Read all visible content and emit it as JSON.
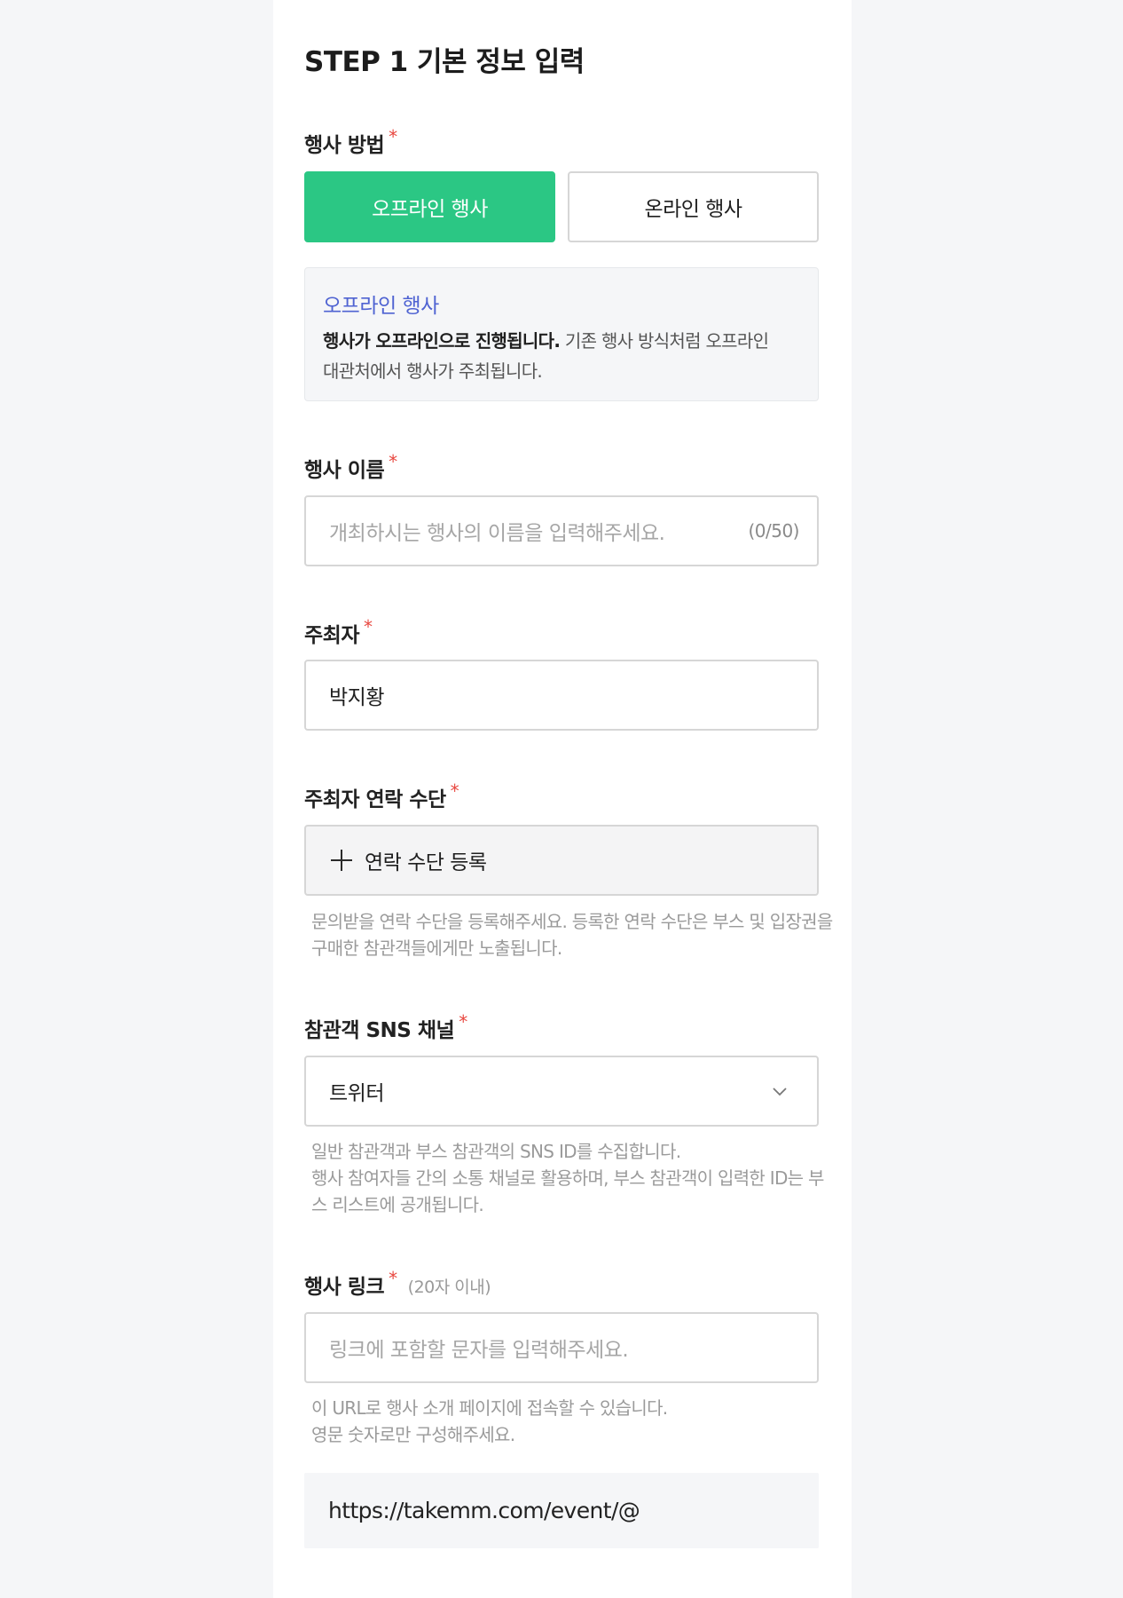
{
  "step_title": "STEP 1 기본 정보 입력",
  "required_mark": "*",
  "event_method": {
    "label": "행사 방법",
    "options": [
      "오프라인 행사",
      "온라인 행사"
    ],
    "selected": "오프라인 행사",
    "info": {
      "title": "오프라인 행사",
      "bold_text": "행사가 오프라인으로 진행됩니다.",
      "line1_rest": " 기존 행사 방식처럼 오프라인",
      "line2": "대관처에서 행사가 주최됩니다."
    }
  },
  "event_name": {
    "label": "행사 이름",
    "placeholder": "개최하시는 행사의 이름을 입력해주세요.",
    "counter": "(0/50)"
  },
  "organizer": {
    "label": "주최자",
    "value": "박지황"
  },
  "contact": {
    "label": "주최자 연락 수단",
    "add_label": "연락 수단 등록",
    "help": [
      "문의받을 연락 수단을 등록해주세요. 등록한 연락 수단은 부스 및 입장권을",
      "구매한 참관객들에게만 노출됩니다."
    ]
  },
  "sns": {
    "label": "참관객 SNS 채널",
    "selected": "트위터",
    "help": [
      "일반 참관객과 부스 참관객의 SNS ID를 수집합니다.",
      "행사 참여자들 간의 소통 채널로 활용하며, 부스 참관객이 입력한 ID는 부",
      "스 리스트에 공개됩니다."
    ]
  },
  "event_link": {
    "label": "행사 링크",
    "hint": "(20자 이내)",
    "placeholder": "링크에 포함할 문자를 입력해주세요.",
    "help": [
      "이 URL로 행사 소개 페이지에 접속할 수 있습니다.",
      "영문 숫자로만 구성해주세요."
    ],
    "url_prefix": "https://takemm.com/event/@"
  },
  "colors": {
    "accent_green": "#2bc784",
    "info_blue": "#4f63d2",
    "required_red": "#e8473f"
  },
  "icons": {
    "add": "plus-icon",
    "dropdown": "chevron-down-icon"
  }
}
